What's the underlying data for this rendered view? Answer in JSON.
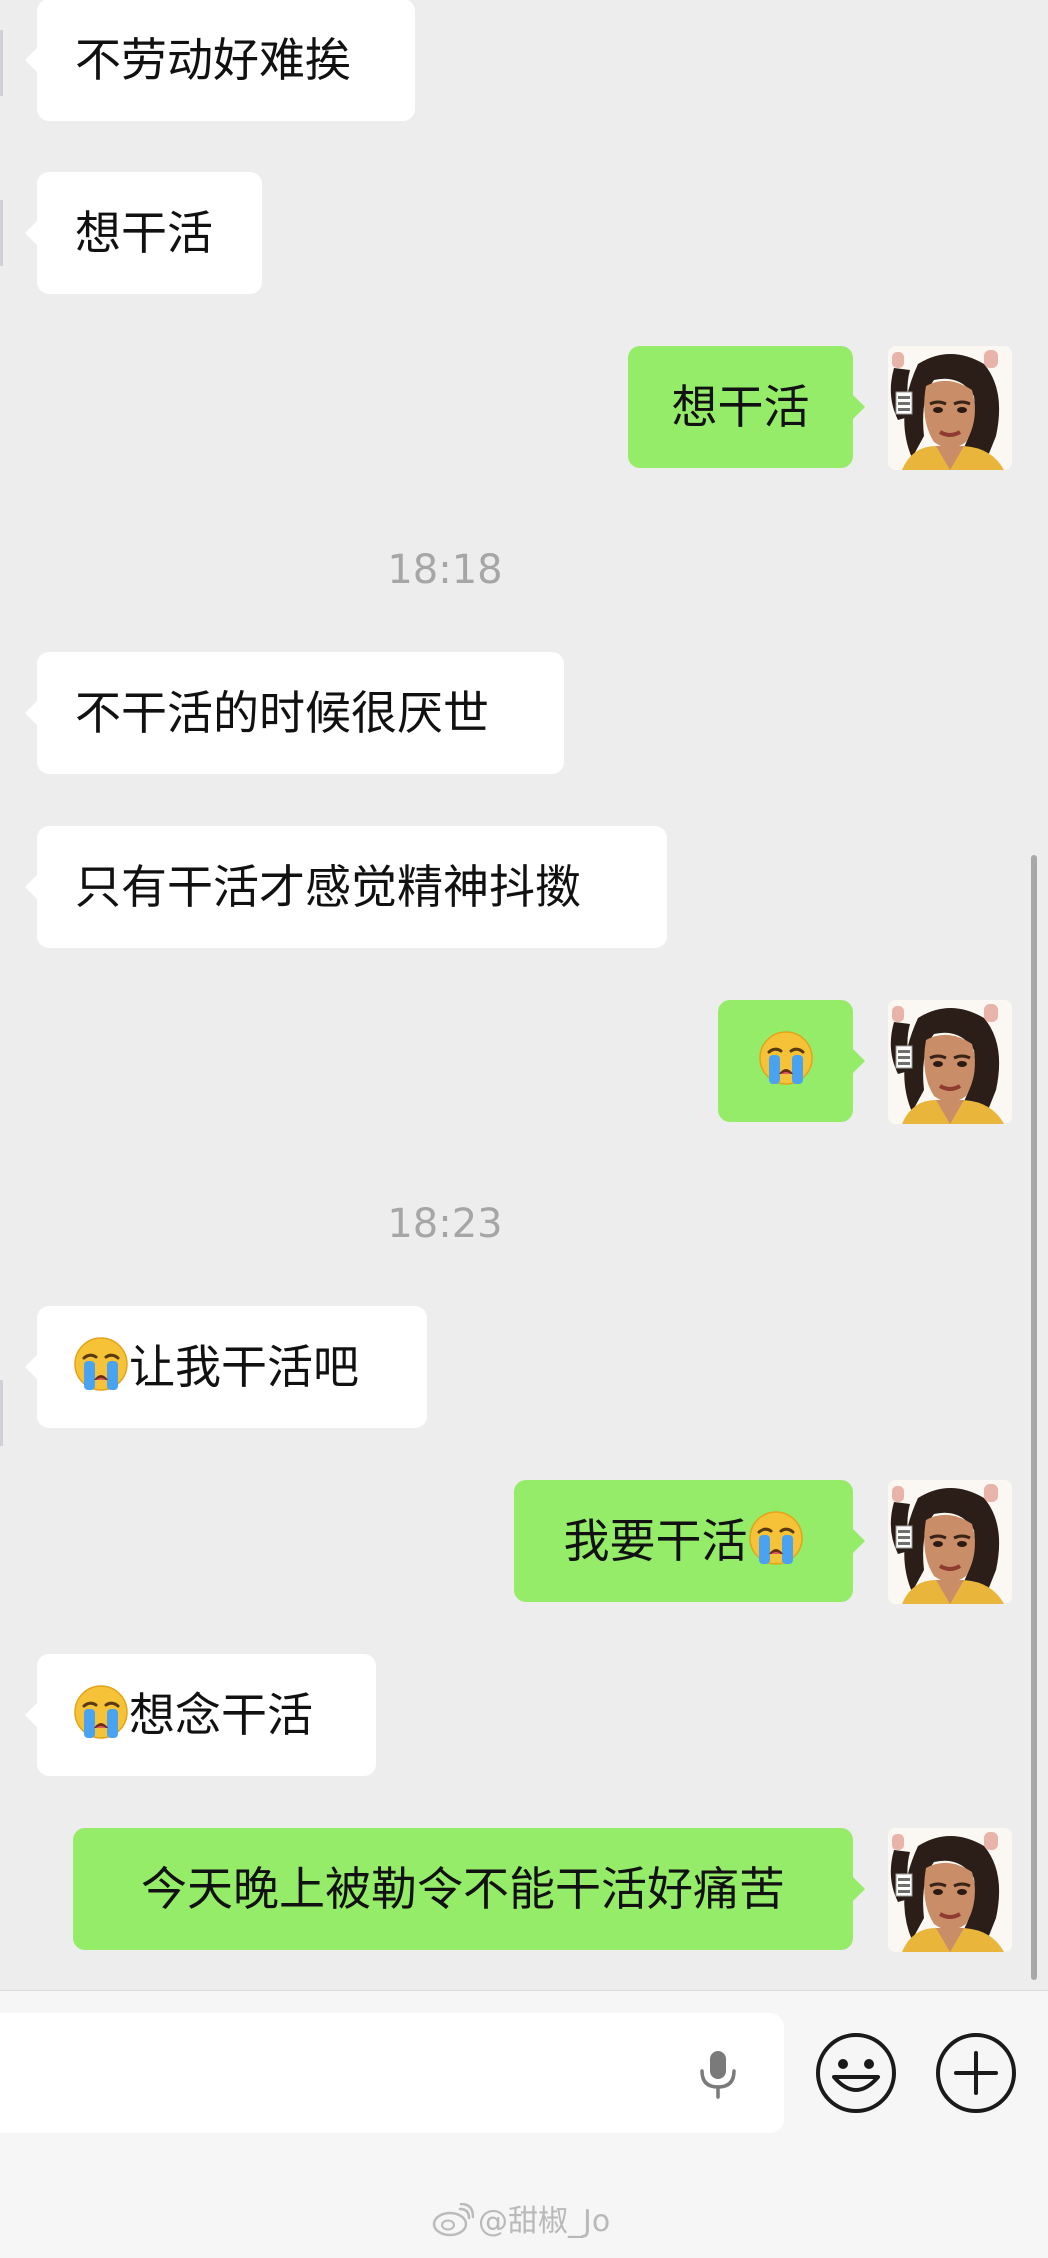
{
  "messages": [
    {
      "side": "in",
      "text": "不劳动好难挨"
    },
    {
      "side": "in",
      "text": "想干活"
    },
    {
      "side": "out",
      "text": "想干活"
    },
    {
      "side": "in",
      "text": "不干活的时候很厌世"
    },
    {
      "side": "in",
      "text": "只有干活才感觉精神抖擞"
    },
    {
      "side": "out",
      "emoji": "loudly-crying-face"
    },
    {
      "side": "in",
      "emoji_prefix": "loudly-crying-face",
      "text": "让我干活吧"
    },
    {
      "side": "out",
      "text": "我要干活",
      "emoji_suffix": "loudly-crying-face"
    },
    {
      "side": "in",
      "emoji_prefix": "loudly-crying-face",
      "text": "想念干活"
    },
    {
      "side": "out",
      "text": "今天晚上被勒令不能干活好痛苦"
    }
  ],
  "timestamps": [
    "18:18",
    "18:23"
  ],
  "input_bar": {
    "placeholder": "",
    "icons": [
      "microphone-icon",
      "emoji-icon",
      "plus-icon"
    ]
  },
  "watermark": {
    "icon": "weibo-icon",
    "text": "@甜椒_Jo"
  },
  "colors": {
    "background": "#ededed",
    "incoming_bubble": "#ffffff",
    "outgoing_bubble": "#95ec69",
    "timestamp": "#a6a6a6"
  }
}
